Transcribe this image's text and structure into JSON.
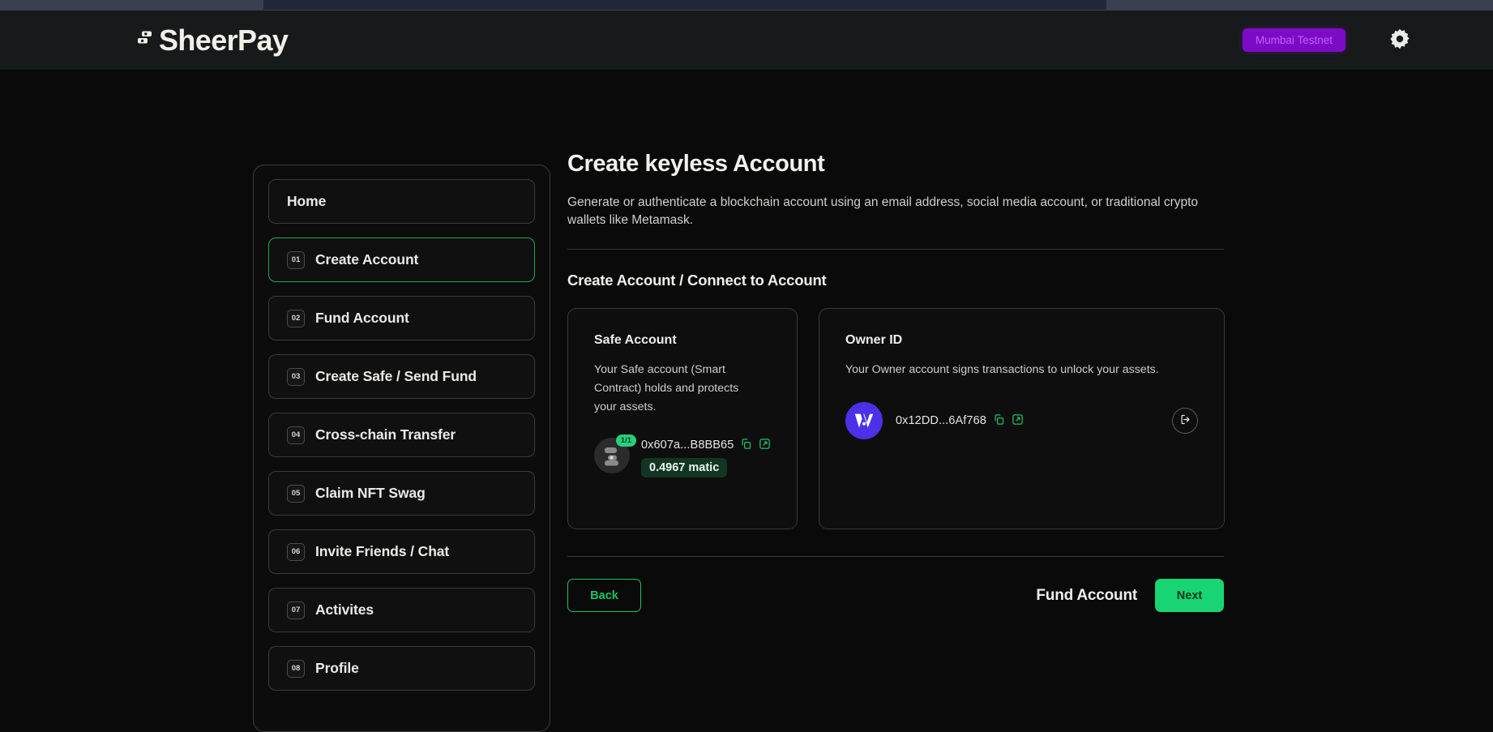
{
  "scrollbar": {
    "present": true
  },
  "header": {
    "brand_name": "SheerPay",
    "brand_mark_icon": "stacked-blocks-icon",
    "network_badge": "Mumbai Testnet",
    "settings_icon": "gear-icon"
  },
  "sidebar": {
    "items": [
      {
        "num": "",
        "label": "Home",
        "active": false
      },
      {
        "num": "01",
        "label": "Create Account",
        "active": true
      },
      {
        "num": "02",
        "label": "Fund Account",
        "active": false
      },
      {
        "num": "03",
        "label": "Create Safe / Send Fund",
        "active": false
      },
      {
        "num": "04",
        "label": "Cross-chain Transfer",
        "active": false
      },
      {
        "num": "05",
        "label": "Claim NFT Swag",
        "active": false
      },
      {
        "num": "06",
        "label": "Invite Friends / Chat",
        "active": false
      },
      {
        "num": "07",
        "label": "Activites",
        "active": false
      },
      {
        "num": "08",
        "label": "Profile",
        "active": false
      }
    ]
  },
  "main": {
    "title": "Create keyless Account",
    "subtitle": "Generate or authenticate a blockchain account using an email address, social media account, or traditional crypto wallets like Metamask.",
    "section_title": "Create Account / Connect to Account",
    "safe_card": {
      "title": "Safe Account",
      "description": "Your Safe account (Smart Contract) holds and protects your assets.",
      "avatar_icon": "safe-identicon",
      "count_badge": "1/1",
      "address": "0x607a...B8BB65",
      "copy_icon": "copy-icon",
      "external_icon": "external-link-icon",
      "balance": "0.4967 matic"
    },
    "owner_card": {
      "title": "Owner ID",
      "description": "Your Owner account signs transactions to unlock your assets.",
      "avatar_icon": "web3auth-w-icon",
      "address": "0x12DD...6Af768",
      "copy_icon": "copy-icon",
      "external_icon": "external-link-icon",
      "logout_icon": "logout-icon"
    },
    "actions": {
      "back_label": "Back",
      "fund_label": "Fund Account",
      "next_label": "Next"
    }
  },
  "colors": {
    "accent_green": "#19d472",
    "badge_purple": "#7d0bc6",
    "owner_avatar_purple": "#4b31e8",
    "page_bg": "#0a0a0a",
    "header_bg": "#171a1a"
  }
}
